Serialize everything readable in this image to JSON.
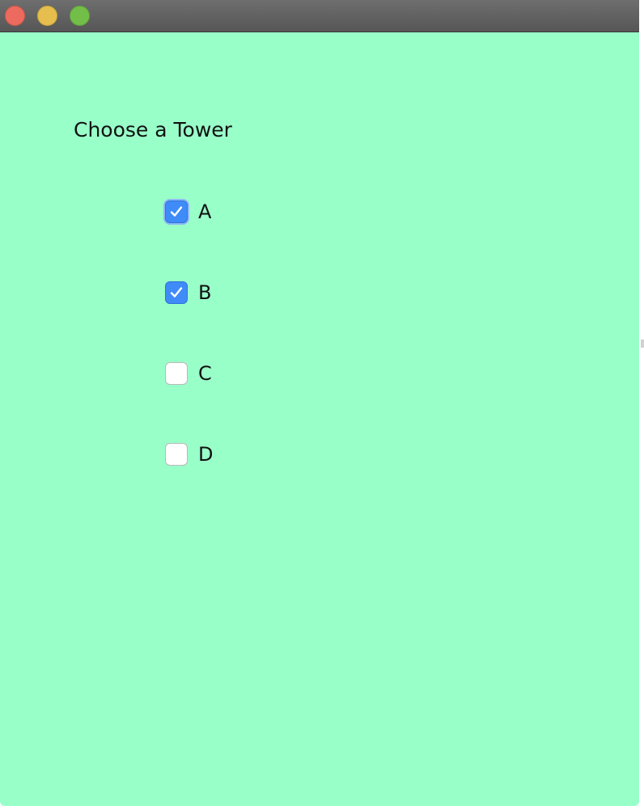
{
  "window": {
    "background_color": "#99ffc9",
    "title_bar_buttons": [
      {
        "name": "close",
        "color": "#ec6a5e"
      },
      {
        "name": "minimize",
        "color": "#e5be4e"
      },
      {
        "name": "zoom",
        "color": "#73be49"
      }
    ]
  },
  "content": {
    "heading": "Choose a Tower",
    "options": [
      {
        "label": "A",
        "checked": true,
        "focused": true
      },
      {
        "label": "B",
        "checked": true,
        "focused": false
      },
      {
        "label": "C",
        "checked": false,
        "focused": false
      },
      {
        "label": "D",
        "checked": false,
        "focused": false
      }
    ],
    "checkbox_checked_color": "#3f8bf8"
  }
}
